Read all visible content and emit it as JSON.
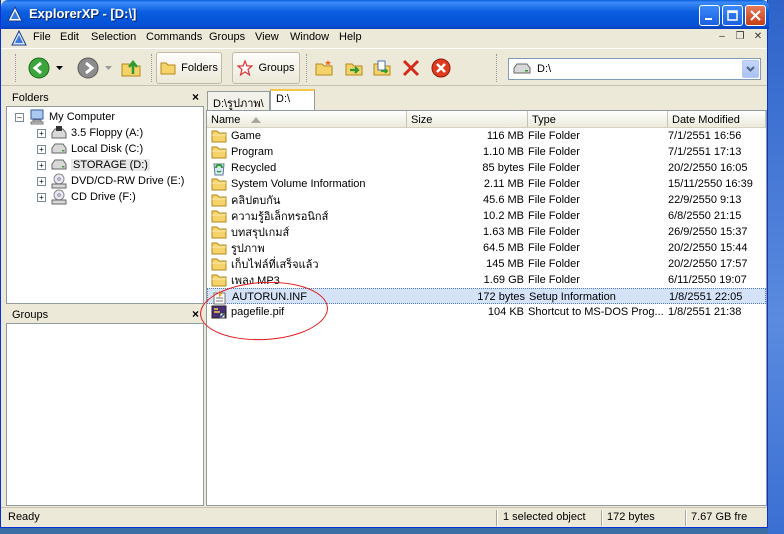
{
  "window": {
    "title": "ExplorerXP - [D:\\]"
  },
  "menu": {
    "items": [
      "File",
      "Edit",
      "Selection",
      "Commands",
      "Groups",
      "View",
      "Window",
      "Help"
    ]
  },
  "toolbar": {
    "folders_label": "Folders",
    "groups_label": "Groups",
    "address_value": "D:\\"
  },
  "folders_pane": {
    "title": "Folders",
    "tree": [
      {
        "label": "My Computer",
        "icon": "computer-icon"
      },
      {
        "label": "3.5 Floppy (A:)",
        "icon": "floppy-icon"
      },
      {
        "label": "Local Disk (C:)",
        "icon": "hard-disk-icon"
      },
      {
        "label": "STORAGE (D:)",
        "icon": "hard-disk-icon"
      },
      {
        "label": "DVD/CD-RW Drive (E:)",
        "icon": "cd-drive-icon"
      },
      {
        "label": "CD Drive (F:)",
        "icon": "cd-drive-icon"
      }
    ]
  },
  "groups_pane": {
    "title": "Groups"
  },
  "tabs": [
    "D:\\รูปภาพ\\",
    "D:\\"
  ],
  "columns": {
    "name": "Name",
    "size": "Size",
    "type": "Type",
    "date": "Date Modified"
  },
  "files": [
    {
      "name": "Game",
      "size": "116 MB",
      "type": "File Folder",
      "date": "7/1/2551 16:56",
      "icon": "folder-icon"
    },
    {
      "name": "Program",
      "size": "1.10 MB",
      "type": "File Folder",
      "date": "7/1/2551 17:13",
      "icon": "folder-icon"
    },
    {
      "name": "Recycled",
      "size": "85 bytes",
      "type": "File Folder",
      "date": "20/2/2550 16:05",
      "icon": "recycle-bin-icon"
    },
    {
      "name": "System Volume Information",
      "size": "2.11 MB",
      "type": "File Folder",
      "date": "15/11/2550 16:39",
      "icon": "folder-icon"
    },
    {
      "name": "คลิปตบกัน",
      "size": "45.6 MB",
      "type": "File Folder",
      "date": "22/9/2550 9:13",
      "icon": "folder-icon"
    },
    {
      "name": "ความรู้อิเล็กทรอนิกส์",
      "size": "10.2 MB",
      "type": "File Folder",
      "date": "6/8/2550 21:15",
      "icon": "folder-icon"
    },
    {
      "name": "บทสรุปเกมส์",
      "size": "1.63 MB",
      "type": "File Folder",
      "date": "26/9/2550 15:37",
      "icon": "folder-icon"
    },
    {
      "name": "รูปภาพ",
      "size": "64.5 MB",
      "type": "File Folder",
      "date": "20/2/2550 15:44",
      "icon": "folder-icon"
    },
    {
      "name": "เก็บไฟล์ที่เสร็จแล้ว",
      "size": "145 MB",
      "type": "File Folder",
      "date": "20/2/2550 17:57",
      "icon": "folder-icon"
    },
    {
      "name": "เพลง MP3",
      "size": "1.69 GB",
      "type": "File Folder",
      "date": "6/11/2550 19:07",
      "icon": "folder-icon"
    },
    {
      "name": "AUTORUN.INF",
      "size": "172 bytes",
      "type": "Setup Information",
      "date": "1/8/2551 22:05",
      "icon": "setup-file-icon"
    },
    {
      "name": "pagefile.pif",
      "size": "104 KB",
      "type": "Shortcut to MS-DOS Prog...",
      "date": "1/8/2551 21:38",
      "icon": "pif-shortcut-icon"
    }
  ],
  "selected_row": 10,
  "status": {
    "ready": "Ready",
    "selection": "1 selected object",
    "selection_size": "172 bytes",
    "free_space": "7.67 GB fre"
  }
}
